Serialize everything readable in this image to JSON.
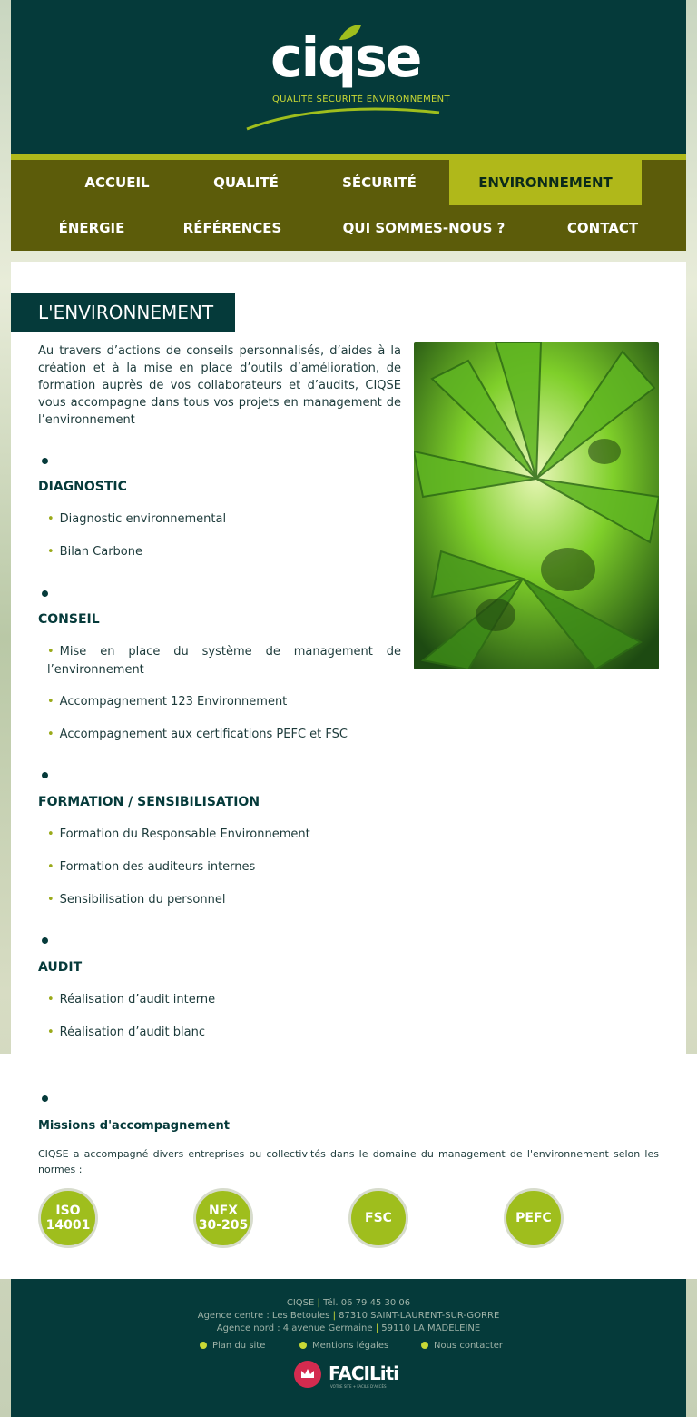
{
  "brand": {
    "name": "ciqse",
    "tagline": "QUALITÉ SÉCURITÉ ENVIRONNEMENT"
  },
  "nav": {
    "row1": [
      "ACCUEIL",
      "QUALITÉ",
      "SÉCURITÉ",
      "ENVIRONNEMENT"
    ],
    "row2": [
      "ÉNERGIE",
      "RÉFÉRENCES",
      "QUI SOMMES-NOUS ?",
      "CONTACT"
    ],
    "active": "ENVIRONNEMENT"
  },
  "page": {
    "title": "L'ENVIRONNEMENT",
    "intro": "Au travers d’actions de conseils personnalisés, d’aides à la création et à la mise en place d’outils d’amélioration, de formation auprès de vos collaborateurs et d’audits, CIQSE vous accompagne dans tous vos projets en management de l’environnement",
    "sections": [
      {
        "title": "DIAGNOSTIC",
        "items": [
          "Diagnostic environnemental",
          "Bilan Carbone"
        ]
      },
      {
        "title": "CONSEIL",
        "items": [
          "Mise en place du système de management de l’environnement",
          "Accompagnement 123 Environnement",
          "Accompagnement aux certifications PEFC et FSC"
        ]
      },
      {
        "title": "FORMATION / SENSIBILISATION",
        "items": [
          "Formation du Responsable Environnement",
          "Formation des auditeurs internes",
          "Sensibilisation du personnel"
        ]
      },
      {
        "title": "AUDIT",
        "items": [
          "Réalisation d’audit interne",
          "Réalisation d’audit blanc"
        ]
      }
    ]
  },
  "missions": {
    "title": "Missions d'accompagnement",
    "text": "CIQSE a accompagné divers entreprises ou collectivités dans le domaine du management de l'environnement selon les normes :",
    "badges": [
      {
        "line1": "ISO",
        "line2": "14001"
      },
      {
        "line1": "NFX",
        "line2": "30-205"
      },
      {
        "line1": "FSC",
        "line2": ""
      },
      {
        "line1": "PEFC",
        "line2": ""
      }
    ]
  },
  "footer": {
    "company": "CIQSE",
    "phone": "Tél. 06 79 45 30 06",
    "agence_centre_label": "Agence centre : Les Betoules",
    "agence_centre_city": "87310 SAINT-LAURENT-SUR-GORRE",
    "agence_nord_label": "Agence nord : 4 avenue Germaine",
    "agence_nord_city": "59110 LA MADELEINE",
    "links": [
      "Plan du site",
      "Mentions légales",
      "Nous contacter"
    ],
    "partner": "FACILiti",
    "partner_sub": "VOTRE SITE + FACILE D'ACCÈS"
  },
  "colors": {
    "dark_teal": "#053a3a",
    "olive": "#5c5c0a",
    "lime": "#b0b81a",
    "badge_green": "#9fbe1d"
  }
}
